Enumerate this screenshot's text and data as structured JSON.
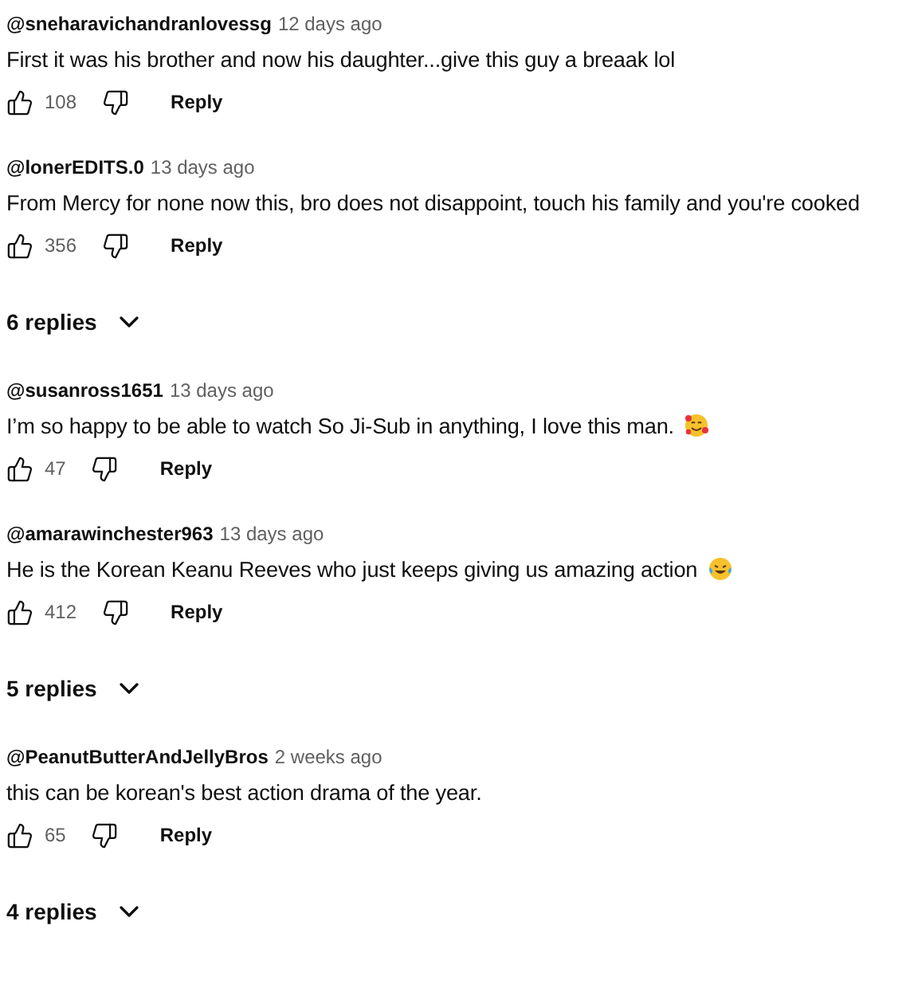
{
  "comments": [
    {
      "author": "@sneharavichandranlovessg",
      "time": "12 days ago",
      "text": "First it was his brother and now his daughter...give this guy a breaak lol",
      "likes": "108",
      "reply_label": "Reply"
    },
    {
      "author": "@lonerEDITS.0",
      "time": "13 days ago",
      "text": "From Mercy for none now this, bro does not disappoint, touch his family and you're cooked",
      "likes": "356",
      "reply_label": "Reply",
      "replies": "6 replies"
    },
    {
      "author": "@susanross1651",
      "time": "13 days ago",
      "text": "I’m so happy to be able to watch So Ji-Sub in anything, I love this man.",
      "emoji": {
        "kind": "hearts"
      },
      "likes": "47",
      "reply_label": "Reply"
    },
    {
      "author": "@amarawinchester963",
      "time": "13 days ago",
      "text": "He is the Korean Keanu Reeves who just keeps giving us amazing action",
      "emoji": {
        "kind": "tears"
      },
      "likes": "412",
      "reply_label": "Reply",
      "replies": "5 replies"
    },
    {
      "author": "@PeanutButterAndJellyBros",
      "time": "2 weeks ago",
      "text": "this can be korean's best action drama of the year.",
      "likes": "65",
      "reply_label": "Reply",
      "replies": "4 replies"
    }
  ]
}
